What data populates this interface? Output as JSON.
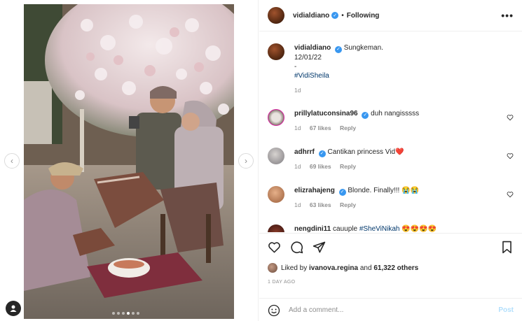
{
  "post": {
    "author": "vidialdiano",
    "follow_state": "Following",
    "header_separator": "•",
    "more_icon": "more-horizontal-icon",
    "caption_lines": [
      "Sungkeman.",
      "12/01/22",
      "-"
    ],
    "hashtag": "#VidiSheila",
    "caption_age": "1d"
  },
  "media": {
    "slides_total": 6,
    "active_slide": 4,
    "prev_icon": "chevron-left-icon",
    "next_icon": "chevron-right-icon",
    "tag_icon": "user-tag-icon"
  },
  "comments": [
    {
      "user": "prillylatuconsina96",
      "text": "duh nangisssss",
      "age": "1d",
      "likes": "67 likes",
      "reply": "Reply"
    },
    {
      "user": "adhrrf",
      "text": "Cantikan princess Vid❤️",
      "age": "1d",
      "likes": "69 likes",
      "reply": "Reply"
    },
    {
      "user": "elizrahajeng",
      "text": "Blonde. Finally!!! 😭😭",
      "age": "1d",
      "likes": "63 likes",
      "reply": "Reply"
    },
    {
      "user": "nengdini11",
      "text": "cauuple ",
      "hashtag": "#SheViNikah",
      "emoji": "😍😍😍😍",
      "age": "",
      "likes": "",
      "reply": ""
    }
  ],
  "actions": {
    "like_icon": "heart-icon",
    "comment_icon": "comment-icon",
    "share_icon": "send-icon",
    "save_icon": "bookmark-icon",
    "liked_by_prefix": "Liked by",
    "liked_by_user": "ivanova.regina",
    "liked_by_and": "and",
    "liked_by_count": "61,322 others",
    "timestamp": "1 DAY AGO"
  },
  "composer": {
    "emoji_icon": "smiley-icon",
    "placeholder": "Add a comment...",
    "post_label": "Post"
  },
  "colors": {
    "link": "#00376b",
    "verified": "#3897f0",
    "muted": "#8e8e8e",
    "post_disabled": "#b2dffc"
  }
}
